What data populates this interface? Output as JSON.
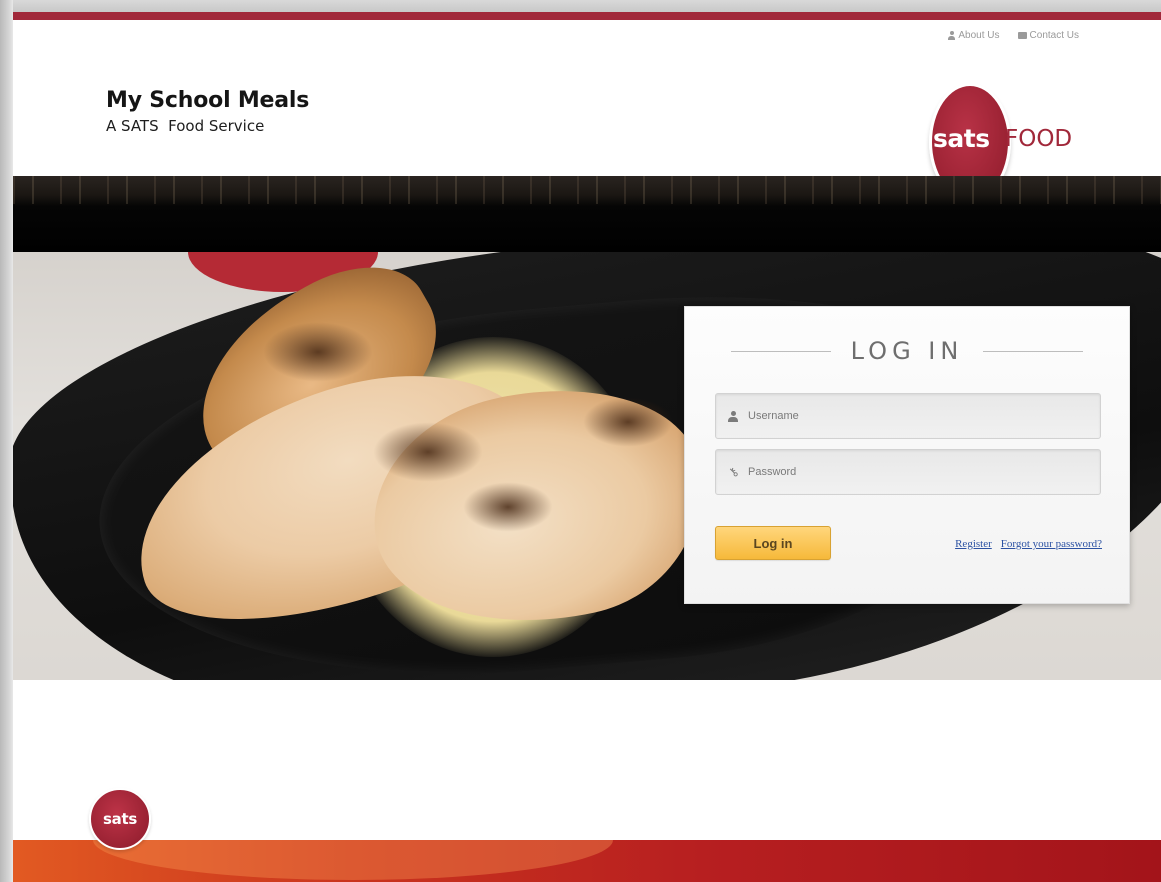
{
  "header": {
    "top_links": [
      {
        "label": "About Us",
        "icon": "person-icon"
      },
      {
        "label": "Contact Us",
        "icon": "card-icon"
      }
    ],
    "brand_title": "My School Meals",
    "brand_subtitle": "A SATS  Food Service",
    "logo": {
      "mark": "sats",
      "word": "FOOD"
    }
  },
  "login": {
    "heading": "LOG IN",
    "username_placeholder": "Username",
    "password_placeholder": "Password",
    "submit_label": "Log in",
    "register_label": "Register",
    "forgot_label": "Forgot your password?"
  },
  "footer": {
    "logo_mark": "sats"
  },
  "colors": {
    "brand": "#a1283a",
    "button": "#f6b93a",
    "link": "#2c52a3"
  }
}
